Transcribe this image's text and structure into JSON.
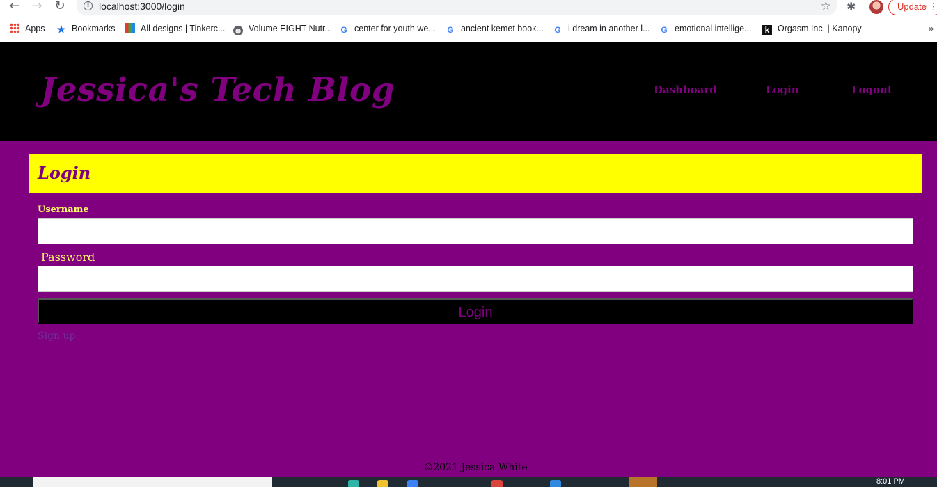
{
  "browser": {
    "url": "localhost:3000/login",
    "update_label": "Update",
    "bookmarks": [
      {
        "label": "Apps",
        "icon": "apps-icon"
      },
      {
        "label": "Bookmarks",
        "icon": "star-icon"
      },
      {
        "label": "All designs | Tinkerc...",
        "icon": "tinkercad-icon"
      },
      {
        "label": "Volume EIGHT Nutr...",
        "icon": "globe-icon"
      },
      {
        "label": "center for youth we...",
        "icon": "google-icon"
      },
      {
        "label": "ancient kemet book...",
        "icon": "google-icon"
      },
      {
        "label": "i dream in another l...",
        "icon": "google-icon"
      },
      {
        "label": "emotional intellige...",
        "icon": "google-icon"
      },
      {
        "label": "Orgasm Inc. | Kanopy",
        "icon": "kanopy-icon"
      }
    ],
    "more_bookmarks": "»"
  },
  "header": {
    "title": "Jessica's Tech Blog",
    "nav": [
      "Dashboard",
      "Login",
      "Logout"
    ]
  },
  "login": {
    "heading": "Login",
    "username_label": "Username",
    "password_label": "Password",
    "username_value": "",
    "password_value": "",
    "submit_label": "Login",
    "signup_label": "Sign up"
  },
  "footer": {
    "text": "©2021 Jessica White"
  },
  "taskbar": {
    "clock": "8:01 PM"
  },
  "colors": {
    "page_bg": "#800080",
    "header_bg": "#000000",
    "accent": "#800080",
    "banner": "#ffff00",
    "label": "#ffff66"
  }
}
